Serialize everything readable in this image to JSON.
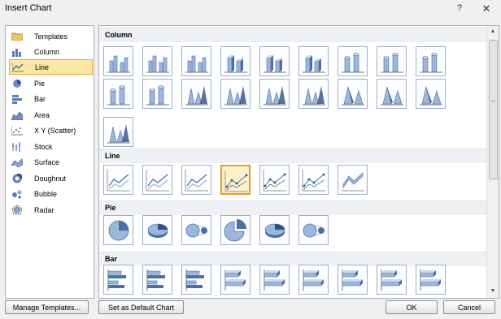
{
  "window": {
    "title": "Insert Chart",
    "help_glyph": "?",
    "close_glyph": "✕"
  },
  "sidebar": {
    "items": [
      {
        "label": "Templates",
        "icon": "folder-icon",
        "selected": false
      },
      {
        "label": "Column",
        "icon": "column-chart-icon",
        "selected": false
      },
      {
        "label": "Line",
        "icon": "line-chart-icon",
        "selected": true
      },
      {
        "label": "Pie",
        "icon": "pie-chart-icon",
        "selected": false
      },
      {
        "label": "Bar",
        "icon": "bar-chart-icon",
        "selected": false
      },
      {
        "label": "Area",
        "icon": "area-chart-icon",
        "selected": false
      },
      {
        "label": "X Y (Scatter)",
        "icon": "scatter-chart-icon",
        "selected": false
      },
      {
        "label": "Stock",
        "icon": "stock-chart-icon",
        "selected": false
      },
      {
        "label": "Surface",
        "icon": "surface-chart-icon",
        "selected": false
      },
      {
        "label": "Doughnut",
        "icon": "doughnut-chart-icon",
        "selected": false
      },
      {
        "label": "Bubble",
        "icon": "bubble-chart-icon",
        "selected": false
      },
      {
        "label": "Radar",
        "icon": "radar-chart-icon",
        "selected": false
      }
    ]
  },
  "gallery": {
    "sections": [
      {
        "title": "Column"
      },
      {
        "title": "Line"
      },
      {
        "title": "Pie"
      },
      {
        "title": "Bar"
      }
    ],
    "selected": "Line / line with markers (4th)"
  },
  "footer": {
    "manage_templates": "Manage Templates...",
    "set_default": "Set as Default Chart",
    "ok": "OK",
    "cancel": "Cancel"
  },
  "colors": {
    "accent": "#e39b2b",
    "selection": "#fbe7a1",
    "chart_blue": "#4a6fa5"
  }
}
